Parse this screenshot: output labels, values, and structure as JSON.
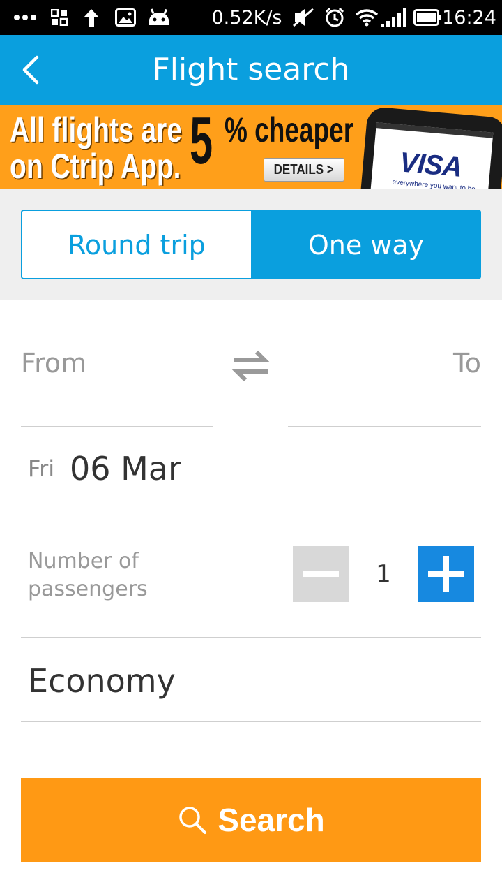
{
  "status_bar": {
    "speed": "0.52K/s",
    "time": "16:24"
  },
  "app_bar": {
    "title": "Flight search"
  },
  "banner": {
    "line1": "All flights are",
    "line2": "on Ctrip App.",
    "big_number": "5",
    "highlight": "% cheaper",
    "details_label": "DETAILS >",
    "card_brand": "VISA",
    "card_tagline": "everywhere you want to be"
  },
  "trip_type": {
    "round_trip": "Round trip",
    "one_way": "One way",
    "selected": "One way"
  },
  "route": {
    "from_placeholder": "From",
    "to_placeholder": "To"
  },
  "date": {
    "day": "Fri",
    "value": "06 Mar"
  },
  "passengers": {
    "label": "Number of passengers",
    "count": "1"
  },
  "cabin": {
    "value": "Economy"
  },
  "search_button": {
    "label": "Search"
  },
  "colors": {
    "primary": "#0a9fde",
    "accent": "#ff9914",
    "plus": "#1789e0"
  }
}
